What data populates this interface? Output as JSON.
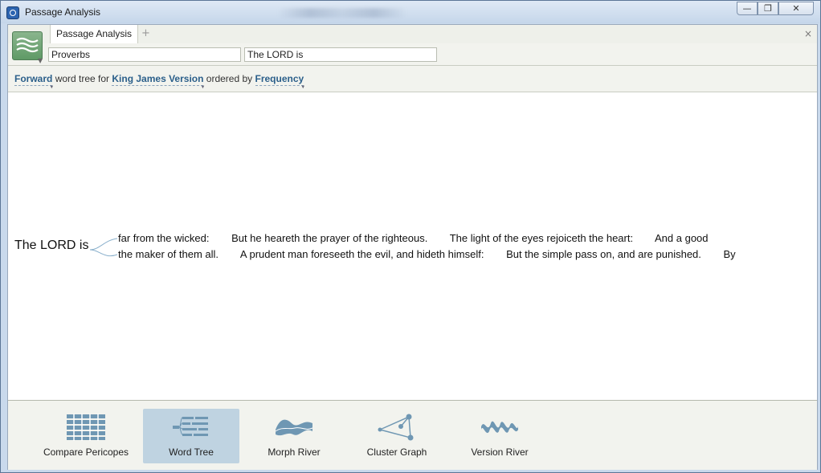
{
  "window": {
    "title": "Passage Analysis",
    "controls": {
      "minimize": "—",
      "restore": "❐",
      "close": "✕"
    }
  },
  "tabs": {
    "active_label": "Passage Analysis",
    "add_label": "+",
    "close_label": "×"
  },
  "inputs": {
    "reference_value": "Proverbs",
    "search_value": "The LORD is"
  },
  "settings": {
    "direction": "Forward",
    "text1": "word tree for",
    "version": "King James Version",
    "text2": "ordered by",
    "order": "Frequency"
  },
  "word_tree": {
    "root": "The LORD is",
    "branches": [
      {
        "segments": [
          "far from the wicked:",
          "But he heareth the prayer of the righteous.",
          "The light of the eyes rejoiceth the heart:",
          "And a good"
        ]
      },
      {
        "segments": [
          "the maker of them all.",
          "A prudent man foreseeth the evil, and hideth himself:",
          "But the simple pass on, and are punished.",
          "By"
        ]
      }
    ]
  },
  "views": [
    {
      "label": "Compare Pericopes",
      "icon": "compare-pericopes-icon",
      "selected": false
    },
    {
      "label": "Word Tree",
      "icon": "word-tree-icon",
      "selected": true
    },
    {
      "label": "Morph River",
      "icon": "morph-river-icon",
      "selected": false
    },
    {
      "label": "Cluster Graph",
      "icon": "cluster-graph-icon",
      "selected": false
    },
    {
      "label": "Version River",
      "icon": "version-river-icon",
      "selected": false
    }
  ],
  "colors": {
    "link": "#2b5f8a",
    "icon": "#6f97b3",
    "selected_view": "#bfd3e1"
  }
}
